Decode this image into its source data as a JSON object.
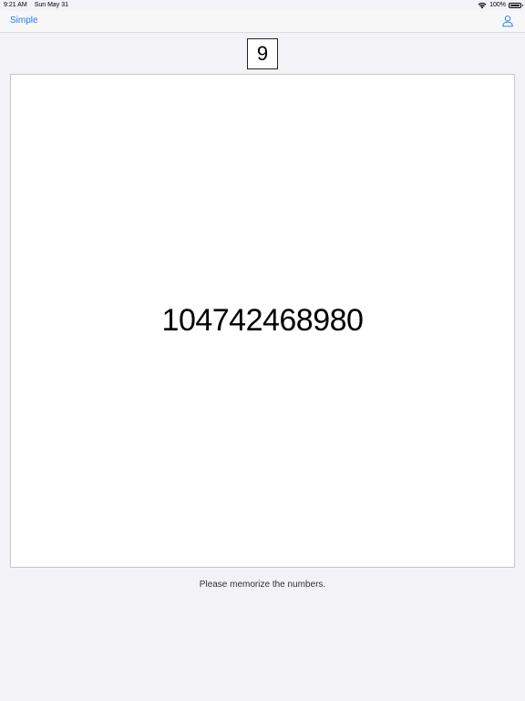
{
  "status_bar": {
    "time": "9:21 AM",
    "date": "Sun May 31",
    "battery_text": "100%",
    "battery_level": 1.0,
    "wifi_icon": "wifi-icon",
    "battery_icon": "battery-icon"
  },
  "nav": {
    "back_label": "Simple",
    "user_icon": "person-icon",
    "accent_color": "#1e7cf2"
  },
  "game": {
    "counter": "9",
    "digits": "104742468980",
    "instruction": "Please memorize the numbers."
  }
}
